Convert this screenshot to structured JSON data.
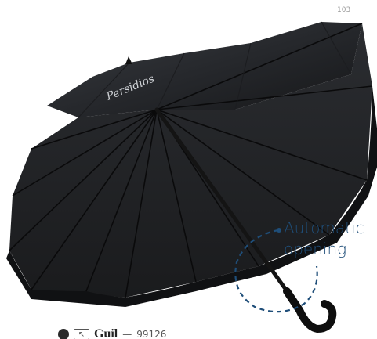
{
  "page": {
    "number": "103"
  },
  "umbrella": {
    "brand_script": "Persidios"
  },
  "callout": {
    "line1": "Automatic",
    "line2": "opening",
    "color": "#1f4e79"
  },
  "product": {
    "name": "Guil",
    "separator": "—",
    "code": "99126",
    "icons": [
      "timer-icon",
      "box-arrow-icon"
    ]
  }
}
